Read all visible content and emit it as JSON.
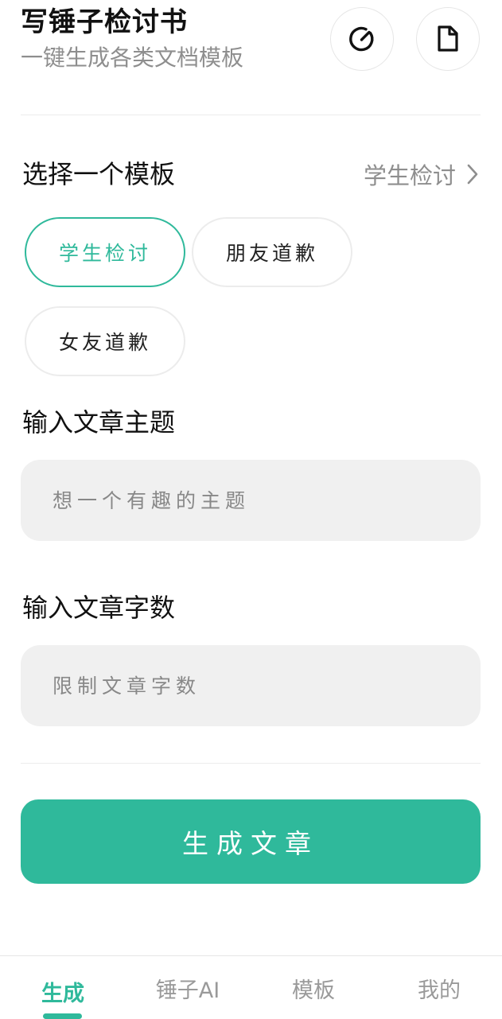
{
  "header": {
    "title": "写锤子检讨书",
    "subtitle": "一键生成各类文档模板",
    "history_icon": "history-icon",
    "document_icon": "document-icon"
  },
  "template_section": {
    "label": "选择一个模板",
    "selected_value": "学生检讨",
    "chevron_icon": "chevron-right-icon",
    "options": [
      {
        "label": "学生检讨",
        "active": true
      },
      {
        "label": "朋友道歉",
        "active": false
      },
      {
        "label": "女友道歉",
        "active": false
      }
    ]
  },
  "topic_section": {
    "label": "输入文章主题",
    "placeholder": "想一个有趣的主题",
    "value": ""
  },
  "length_section": {
    "label": "输入文章字数",
    "placeholder": "限制文章字数",
    "value": ""
  },
  "generate_button": {
    "label": "生成文章"
  },
  "tabbar": {
    "tabs": [
      {
        "label": "生成",
        "active": true
      },
      {
        "label": "锤子AI",
        "active": false
      },
      {
        "label": "模板",
        "active": false
      },
      {
        "label": "我的",
        "active": false
      }
    ]
  },
  "colors": {
    "accent": "#2fb99b",
    "muted_text": "#8e8e8e",
    "input_bg": "#f0f0f0"
  }
}
